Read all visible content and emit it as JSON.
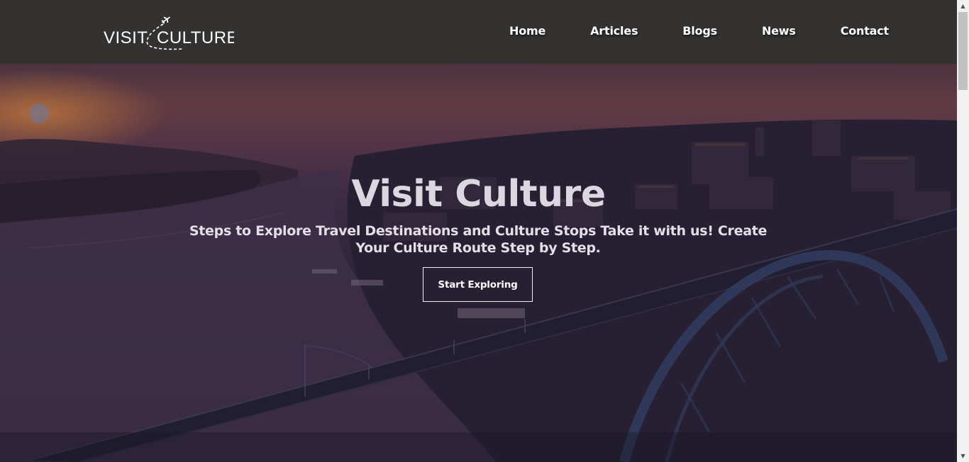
{
  "header": {
    "logo_text_left": "VISIT",
    "logo_text_right": "CULTURE",
    "nav": [
      {
        "label": "Home"
      },
      {
        "label": "Articles"
      },
      {
        "label": "Blogs"
      },
      {
        "label": "News"
      },
      {
        "label": "Contact"
      }
    ]
  },
  "hero": {
    "title": "Visit Culture",
    "subtitle": "Steps to Explore Travel Destinations and Culture Stops Take it with us! Create Your Culture Route Step by Step.",
    "cta_label": "Start Exploring",
    "background_image": "sunset over river city with arched iron bridge"
  },
  "scrollbar": {
    "up_icon": "triangle-up-icon",
    "down_icon": "triangle-down-icon"
  },
  "colors": {
    "header_bg": "#333231",
    "text_light": "#dcd6e0",
    "accent_sun": "#f59646"
  }
}
